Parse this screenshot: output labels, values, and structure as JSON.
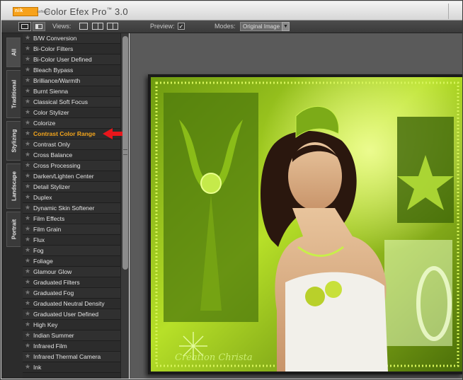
{
  "app": {
    "logo_text": "nik",
    "logo_sub": "software",
    "title_main": "Color Efex Pro",
    "title_tm": "™",
    "title_version": "3.0"
  },
  "toolbar": {
    "views_label": "Views:",
    "preview_label": "Preview:",
    "preview_checked": "✓",
    "modes_label": "Modes:",
    "modes_value": "Original Image"
  },
  "tabs": [
    {
      "label": "All"
    },
    {
      "label": "Traditional"
    },
    {
      "label": "Stylizing"
    },
    {
      "label": "Landscape"
    },
    {
      "label": "Portrait"
    }
  ],
  "filters": {
    "selected": "Contrast Color Range",
    "items": [
      "B/W Conversion",
      "Bi-Color Filters",
      "Bi-Color User Defined",
      "Bleach Bypass",
      "Brilliance/Warmth",
      "Burnt Sienna",
      "Classical Soft Focus",
      "Color Stylizer",
      "Colorize",
      "Contrast Color Range",
      "Contrast Only",
      "Cross Balance",
      "Cross Processing",
      "Darken/Lighten Center",
      "Detail Stylizer",
      "Duplex",
      "Dynamic Skin Softener",
      "Film Effects",
      "Film Grain",
      "Flux",
      "Fog",
      "Foliage",
      "Glamour Glow",
      "Graduated Filters",
      "Graduated Fog",
      "Graduated Neutral Density",
      "Graduated User Defined",
      "High Key",
      "Indian Summer",
      "Infrared Film",
      "Infrared Thermal Camera",
      "Ink"
    ]
  },
  "preview_image": {
    "signature": "Création Christa",
    "accent_color": "#9bd21a"
  },
  "colors": {
    "selected_text": "#f3a51c",
    "annotation_arrow": "#e8161b"
  }
}
